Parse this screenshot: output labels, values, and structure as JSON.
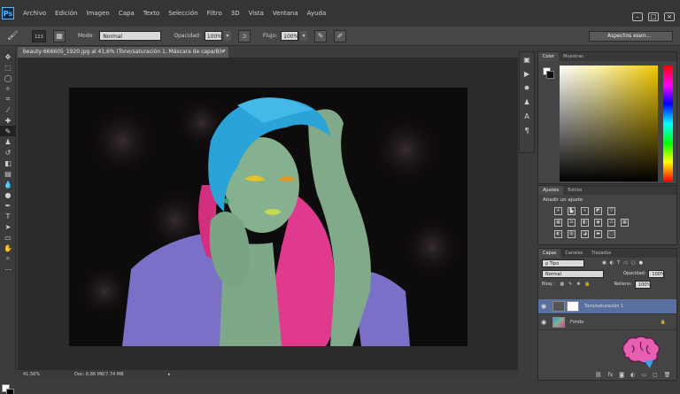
{
  "app": {
    "logo": "Ps"
  },
  "menu": [
    "Archivo",
    "Edición",
    "Imagen",
    "Capa",
    "Texto",
    "Selección",
    "Filtro",
    "3D",
    "Vista",
    "Ventana",
    "Ayuda"
  ],
  "window_controls": {
    "min": "–",
    "max": "□",
    "close": "×"
  },
  "options": {
    "brush_size": "123",
    "mode_label": "Modo:",
    "mode_value": "Normal",
    "opacity_label": "Opacidad:",
    "opacity_value": "100%",
    "flow_label": "Flujo:",
    "flow_value": "100%",
    "workspace": "Aspectos esen..."
  },
  "document": {
    "tab_title": "beauty-666605_1920.jpg al 41,6% (Tono/saturación 1, Máscara de capa/8) *",
    "zoom": "41,56%",
    "doc_info": "Doc: 6,86 MB/7,74 MB"
  },
  "panels": {
    "color": {
      "tabs": [
        "Color",
        "Muestras"
      ]
    },
    "adjustments": {
      "tabs": [
        "Ajustes",
        "Estilos"
      ],
      "title": "Añadir un ajuste"
    },
    "layers": {
      "tabs": [
        "Capas",
        "Canales",
        "Trazados"
      ],
      "filter": "ρ Tipo",
      "blend_mode": "Normal",
      "opacity_label": "Opacidad:",
      "opacity_value": "100%",
      "lock_label": "Bloq.:",
      "fill_label": "Relleno:",
      "fill_value": "100%",
      "layers": [
        {
          "name": "Tono/saturación 1",
          "active": true
        },
        {
          "name": "Fondo",
          "active": false
        }
      ]
    }
  },
  "colors": {
    "accent": "#5870a0",
    "panel": "#444444"
  }
}
